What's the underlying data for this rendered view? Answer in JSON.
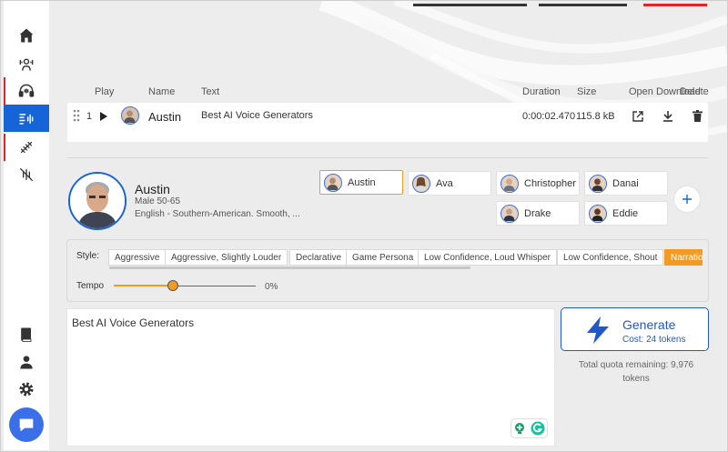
{
  "sidebar": {
    "nav": [
      {
        "icon": "home-icon"
      },
      {
        "icon": "voice-group-icon"
      },
      {
        "icon": "headset-icon"
      },
      {
        "icon": "soundwave-icon"
      },
      {
        "icon": "dna-icon"
      },
      {
        "icon": "voice-changer-icon"
      }
    ],
    "bottom": [
      {
        "icon": "book-icon"
      },
      {
        "icon": "user-icon"
      },
      {
        "icon": "gear-icon"
      }
    ],
    "chat_icon": "chat-icon"
  },
  "table": {
    "headers": {
      "play": "Play",
      "name": "Name",
      "text": "Text",
      "duration": "Duration",
      "size": "Size",
      "open": "Open",
      "download": "Download",
      "delete": "Delete"
    },
    "rows": [
      {
        "index": "1",
        "name": "Austin",
        "text": "Best AI Voice Generators",
        "duration": "0:00:02.470",
        "size": "115.8 kB"
      }
    ]
  },
  "voice": {
    "name": "Austin",
    "meta": "Male 50-65",
    "description": "English - Southern-American. Smooth, ..."
  },
  "voice_chips": [
    {
      "name": "Austin",
      "selected": true
    },
    {
      "name": "Ava",
      "selected": false
    },
    {
      "name": "Christopher",
      "selected": false
    },
    {
      "name": "Danai",
      "selected": false
    },
    {
      "name": "Drake",
      "selected": false
    },
    {
      "name": "Eddie",
      "selected": false
    }
  ],
  "style": {
    "label": "Style:",
    "options": [
      "Aggressive",
      "Aggressive, Slightly Louder",
      "Declarative",
      "Game Persona",
      "Low Confidence, Loud Whisper",
      "Low Confidence, Shout",
      "Narratio"
    ],
    "active": "Narratio"
  },
  "tempo": {
    "label": "Tempo",
    "value": "0%",
    "level": 0.43
  },
  "editor": {
    "text": "Best AI Voice Generators"
  },
  "generate": {
    "label": "Generate",
    "cost": "Cost: 24 tokens"
  },
  "quota": {
    "text": "Total quota remaining: 9,976 tokens"
  },
  "colors": {
    "accent_blue": "#1565d8",
    "accent_orange": "#f39a22",
    "alert_red": "#e0252b"
  }
}
